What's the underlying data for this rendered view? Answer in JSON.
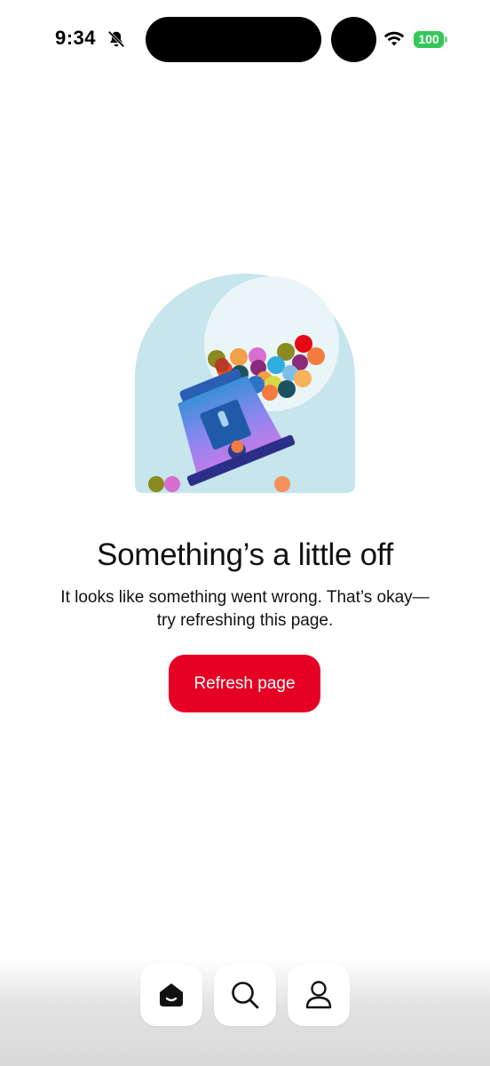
{
  "status_bar": {
    "time": "9:34",
    "battery": "100",
    "icons": [
      "bell-slash-icon",
      "wifi-icon",
      "battery-icon"
    ],
    "battery_color": "#34c759"
  },
  "error": {
    "illustration": "gumball-machine-illustration",
    "title": "Something’s a little off",
    "message": "It looks like something went wrong. That’s okay—try refreshing this page.",
    "refresh_label": "Refresh page"
  },
  "bottom_nav": {
    "items": [
      {
        "icon": "home-icon",
        "active": true
      },
      {
        "icon": "search-icon",
        "active": false
      },
      {
        "icon": "profile-icon",
        "active": false
      }
    ]
  },
  "colors": {
    "accent": "#e60023",
    "background": "#ffffff",
    "text": "#111111"
  }
}
